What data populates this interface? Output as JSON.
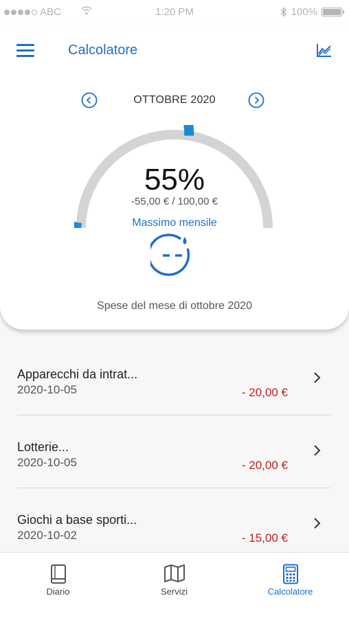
{
  "status_bar": {
    "carrier": "ABC",
    "time": "1:20 PM",
    "battery": "100%"
  },
  "header": {
    "title": "Calcolatore",
    "menu_icon": "hamburger-menu-icon",
    "chart_icon": "chart-icon"
  },
  "month": {
    "label": "OTTOBRE 2020"
  },
  "gauge": {
    "percent_text": "55%",
    "percent_value": 55,
    "amount": "-55,00 € / 100,00 €",
    "limit_label": "Massimo mensile",
    "caption": "Spese del mese di ottobre 2020"
  },
  "colors": {
    "accent": "#1e6fc8",
    "negative": "#c41f1f",
    "track": "#d4d4d4"
  },
  "transactions": [
    {
      "name": "Apparecchi da intrat...",
      "date": "2020-10-05",
      "amount": "- 20,00 €"
    },
    {
      "name": "Lotterie...",
      "date": "2020-10-05",
      "amount": "- 20,00 €"
    },
    {
      "name": "Giochi a base sporti...",
      "date": "2020-10-02",
      "amount": "- 15,00 €"
    }
  ],
  "bottom_nav": {
    "tabs": [
      {
        "label": "Diario",
        "icon": "book-icon",
        "active": false
      },
      {
        "label": "Servizi",
        "icon": "map-icon",
        "active": false
      },
      {
        "label": "Calcolatore",
        "icon": "calculator-icon",
        "active": true
      }
    ]
  }
}
